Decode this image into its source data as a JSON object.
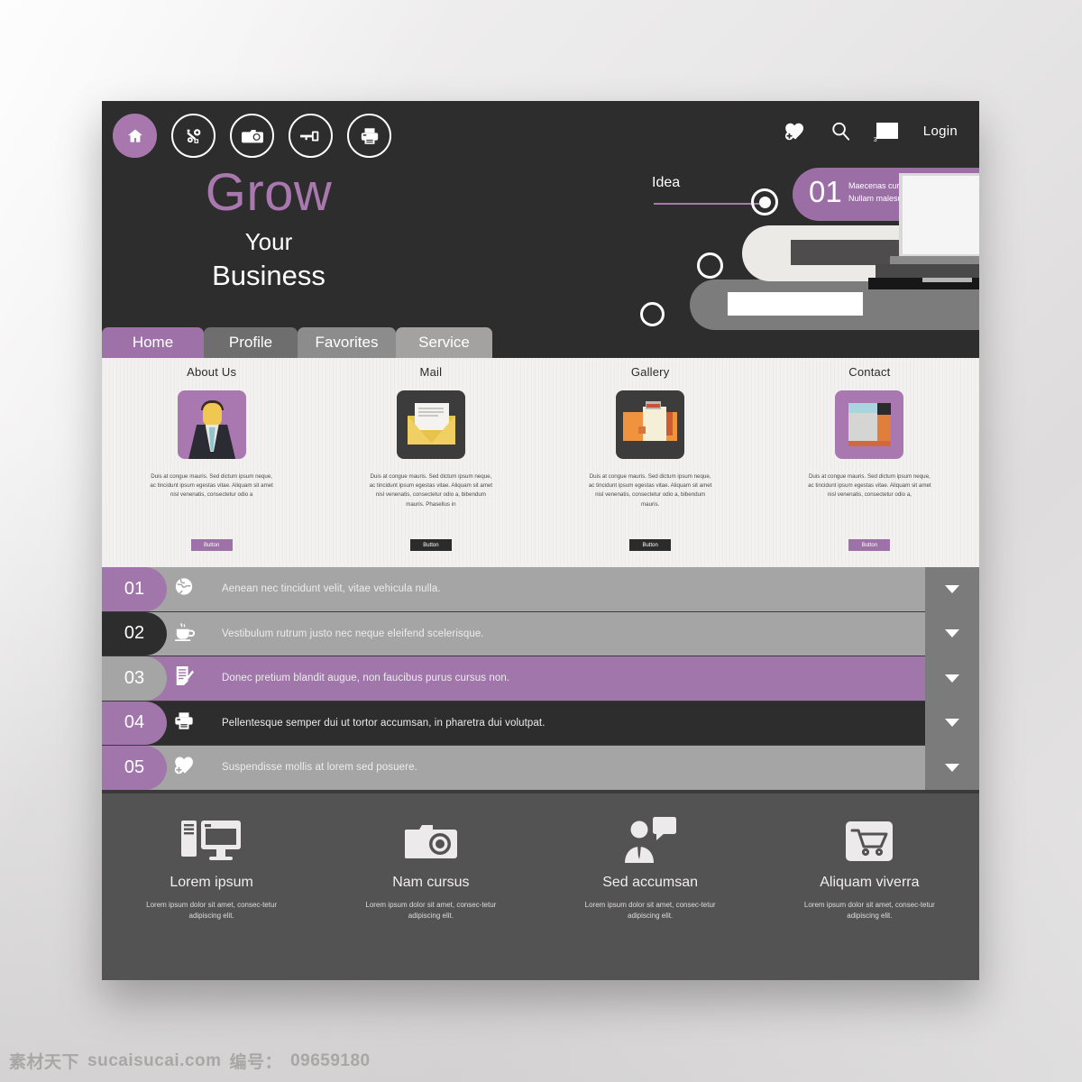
{
  "header": {
    "nav_icons": [
      {
        "name": "home-icon",
        "label": "Home",
        "active": true
      },
      {
        "name": "settings-icon",
        "label": "Settings",
        "active": false
      },
      {
        "name": "camera-icon",
        "label": "Photos",
        "active": false
      },
      {
        "name": "key-icon",
        "label": "Access",
        "active": false
      },
      {
        "name": "printer-icon",
        "label": "Print",
        "active": false
      }
    ],
    "utility_icons": [
      {
        "name": "heart-plus-icon",
        "label": "Favorites"
      },
      {
        "name": "search-icon",
        "label": "Search"
      },
      {
        "name": "mail-icon",
        "label": "Messages",
        "badge": "3"
      }
    ],
    "login_label": "Login"
  },
  "hero": {
    "title_accent": "Grow",
    "title_line2": "Your",
    "title_line3": "Business",
    "slider_label": "Idea",
    "slide_number": "01",
    "slide_text_line1": "Maecenas  cursus",
    "slide_text_line2": "Nullam malesuada"
  },
  "tabs": [
    {
      "label": "Home",
      "active": true
    },
    {
      "label": "Profile",
      "active": false
    },
    {
      "label": "Favorites",
      "active": false
    },
    {
      "label": "Service",
      "active": false
    }
  ],
  "cards": [
    {
      "title": "About Us",
      "icon": "businessman-avatar-icon",
      "body": "Duis at congue mauris. Sed dictum ipsum neque, ac tincidunt ipsum egestas vitae. Aliquam sit amet nisl venenatis, consectetur odio a",
      "button": "Button",
      "style": "purple"
    },
    {
      "title": "Mail",
      "icon": "open-envelope-icon",
      "body": "Duis at congue mauris. Sed dictum ipsum neque, ac tincidunt ipsum egestas vitae. Aliquam sit amet nisl venenatis, consectetur odio a, bibendum mauris. Phasellus in",
      "button": "Button",
      "style": "dark"
    },
    {
      "title": "Gallery",
      "icon": "photo-folder-icon",
      "body": "Duis at congue mauris. Sed dictum ipsum neque, ac tincidunt ipsum egestas vitae. Aliquam sit amet nisl venenatis, consectetur odio a, bibendum mauris.",
      "button": "Button",
      "style": "dark"
    },
    {
      "title": "Contact",
      "icon": "contact-card-icon",
      "body": "Duis at congue mauris. Sed dictum ipsum neque, ac tincidunt ipsum egestas vitae. Aliquam sit amet nisl venenatis, consectetur odio a,",
      "button": "Button",
      "style": "purple"
    }
  ],
  "accordion": [
    {
      "number": "01",
      "icon": "globe-icon",
      "text": "Aenean nec tincidunt velit, vitae vehicula nulla.",
      "row_style": "gray",
      "badge_style": "purple"
    },
    {
      "number": "02",
      "icon": "coffee-cup-icon",
      "text": "Vestibulum rutrum justo nec neque eleifend scelerisque.",
      "row_style": "gray",
      "badge_style": "dark"
    },
    {
      "number": "03",
      "icon": "document-pen-icon",
      "text": "Donec pretium blandit augue, non faucibus purus cursus non.",
      "row_style": "purple",
      "badge_style": "gray"
    },
    {
      "number": "04",
      "icon": "printer-icon",
      "text": "Pellentesque semper dui ut tortor accumsan, in pharetra dui volutpat.",
      "row_style": "dark",
      "badge_style": "purple"
    },
    {
      "number": "05",
      "icon": "heart-plus-icon",
      "text": "Suspendisse mollis at lorem sed posuere.",
      "row_style": "gray",
      "badge_style": "purple"
    }
  ],
  "footer": [
    {
      "icon": "desktop-computer-icon",
      "title": "Lorem ipsum",
      "text": "Lorem ipsum dolor sit amet, consec-tetur adipiscing elit."
    },
    {
      "icon": "camera-icon",
      "title": "Nam cursus",
      "text": "Lorem ipsum dolor sit amet, consec-tetur adipiscing elit."
    },
    {
      "icon": "person-chat-icon",
      "title": "Sed accumsan",
      "text": "Lorem ipsum dolor sit amet, consec-tetur adipiscing elit."
    },
    {
      "icon": "shopping-cart-icon",
      "title": "Aliquam viverra",
      "text": "Lorem ipsum dolor sit amet, consec-tetur adipiscing elit."
    }
  ],
  "watermark": {
    "cn": "素材天下",
    "site": "sucaisucai.com",
    "id_label": "编号：",
    "id_value": "09659180"
  },
  "colors": {
    "accent_purple": "#a176ab",
    "dark": "#2e2d2d",
    "gray": "#a6a5a5",
    "footer_bg": "#545353"
  }
}
